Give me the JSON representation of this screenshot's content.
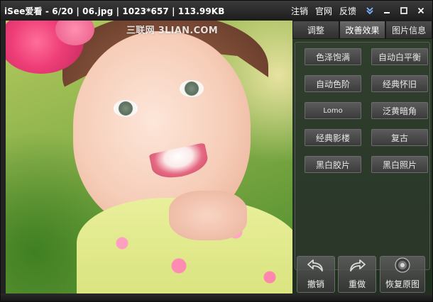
{
  "window": {
    "title": "iSee爱看 - 6/20 | 06.jpg | 1023*657 | 113.99KB"
  },
  "titlebar": {
    "links": [
      "注销",
      "官网",
      "反馈"
    ],
    "icons": [
      "double-chevron-down-icon",
      "minimize-icon",
      "maximize-icon",
      "close-icon"
    ]
  },
  "photo": {
    "watermark": "三联网 3LIAN.COM"
  },
  "panel": {
    "tabs": [
      {
        "label": "调整",
        "active": false
      },
      {
        "label": "改善效果",
        "active": true
      },
      {
        "label": "图片信息",
        "active": false
      }
    ],
    "effects": [
      "色泽饱满",
      "自动白平衡",
      "自动色阶",
      "经典怀旧",
      "Lomo",
      "泛黄暗角",
      "经典影楼",
      "复古",
      "黑白胶片",
      "黑白照片"
    ],
    "actions": [
      {
        "label": "撤销",
        "icon": "undo-icon"
      },
      {
        "label": "重做",
        "icon": "redo-icon"
      },
      {
        "label": "恢复原图",
        "icon": "restore-icon"
      }
    ]
  }
}
